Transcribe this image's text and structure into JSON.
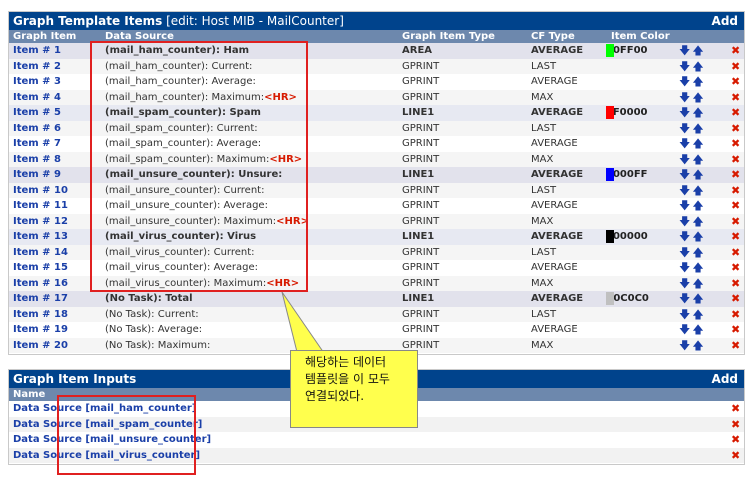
{
  "template_panel": {
    "title_bold": "Graph Template Items",
    "title_rest": "[edit: Host MIB - MailCounter]",
    "add_label": "Add",
    "columns": {
      "item": "Graph Item",
      "ds": "Data Source",
      "type": "Graph Item Type",
      "cf": "CF Type",
      "color": "Item Color"
    },
    "rows": [
      {
        "item": "Item # 1",
        "ds": "(mail_ham_counter): Ham",
        "hr": "",
        "type": "AREA",
        "cf": "AVERAGE",
        "color": "00FF00",
        "swatch": "#00ff00",
        "main": true
      },
      {
        "item": "Item # 2",
        "ds": "(mail_ham_counter): Current:",
        "hr": "",
        "type": "GPRINT",
        "cf": "LAST",
        "color": "",
        "swatch": "",
        "main": false
      },
      {
        "item": "Item # 3",
        "ds": "(mail_ham_counter): Average:",
        "hr": "",
        "type": "GPRINT",
        "cf": "AVERAGE",
        "color": "",
        "swatch": "",
        "main": false
      },
      {
        "item": "Item # 4",
        "ds": "(mail_ham_counter): Maximum:",
        "hr": "<HR>",
        "type": "GPRINT",
        "cf": "MAX",
        "color": "",
        "swatch": "",
        "main": false
      },
      {
        "item": "Item # 5",
        "ds": "(mail_spam_counter): Spam",
        "hr": "",
        "type": "LINE1",
        "cf": "AVERAGE",
        "color": "FF0000",
        "swatch": "#ff0000",
        "main": true
      },
      {
        "item": "Item # 6",
        "ds": "(mail_spam_counter): Current:",
        "hr": "",
        "type": "GPRINT",
        "cf": "LAST",
        "color": "",
        "swatch": "",
        "main": false
      },
      {
        "item": "Item # 7",
        "ds": "(mail_spam_counter): Average:",
        "hr": "",
        "type": "GPRINT",
        "cf": "AVERAGE",
        "color": "",
        "swatch": "",
        "main": false
      },
      {
        "item": "Item # 8",
        "ds": "(mail_spam_counter): Maximum:",
        "hr": "<HR>",
        "type": "GPRINT",
        "cf": "MAX",
        "color": "",
        "swatch": "",
        "main": false
      },
      {
        "item": "Item # 9",
        "ds": "(mail_unsure_counter): Unsure:",
        "hr": "",
        "type": "LINE1",
        "cf": "AVERAGE",
        "color": "0000FF",
        "swatch": "#0000ff",
        "main": true
      },
      {
        "item": "Item # 10",
        "ds": "(mail_unsure_counter): Current:",
        "hr": "",
        "type": "GPRINT",
        "cf": "LAST",
        "color": "",
        "swatch": "",
        "main": false
      },
      {
        "item": "Item # 11",
        "ds": "(mail_unsure_counter): Average:",
        "hr": "",
        "type": "GPRINT",
        "cf": "AVERAGE",
        "color": "",
        "swatch": "",
        "main": false
      },
      {
        "item": "Item # 12",
        "ds": "(mail_unsure_counter): Maximum:",
        "hr": "<HR>",
        "type": "GPRINT",
        "cf": "MAX",
        "color": "",
        "swatch": "",
        "main": false
      },
      {
        "item": "Item # 13",
        "ds": "(mail_virus_counter): Virus",
        "hr": "",
        "type": "LINE1",
        "cf": "AVERAGE",
        "color": "000000",
        "swatch": "#000000",
        "main": true
      },
      {
        "item": "Item # 14",
        "ds": "(mail_virus_counter): Current:",
        "hr": "",
        "type": "GPRINT",
        "cf": "LAST",
        "color": "",
        "swatch": "",
        "main": false
      },
      {
        "item": "Item # 15",
        "ds": "(mail_virus_counter): Average:",
        "hr": "",
        "type": "GPRINT",
        "cf": "AVERAGE",
        "color": "",
        "swatch": "",
        "main": false
      },
      {
        "item": "Item # 16",
        "ds": "(mail_virus_counter): Maximum:",
        "hr": "<HR>",
        "type": "GPRINT",
        "cf": "MAX",
        "color": "",
        "swatch": "",
        "main": false
      },
      {
        "item": "Item # 17",
        "ds": "(No Task): Total",
        "hr": "",
        "type": "LINE1",
        "cf": "AVERAGE",
        "color": "C0C0C0",
        "swatch": "#c0c0c0",
        "main": true
      },
      {
        "item": "Item # 18",
        "ds": "(No Task): Current:",
        "hr": "",
        "type": "GPRINT",
        "cf": "LAST",
        "color": "",
        "swatch": "",
        "main": false
      },
      {
        "item": "Item # 19",
        "ds": "(No Task): Average:",
        "hr": "",
        "type": "GPRINT",
        "cf": "AVERAGE",
        "color": "",
        "swatch": "",
        "main": false
      },
      {
        "item": "Item # 20",
        "ds": "(No Task): Maximum:",
        "hr": "",
        "type": "GPRINT",
        "cf": "MAX",
        "color": "",
        "swatch": "",
        "main": false
      }
    ]
  },
  "inputs_panel": {
    "title": "Graph Item Inputs",
    "add_label": "Add",
    "name_header": "Name",
    "rows": [
      "Data Source [mail_ham_counter]",
      "Data Source [mail_spam_counter]",
      "Data Source [mail_unsure_counter]",
      "Data Source [mail_virus_counter]"
    ]
  },
  "callout": {
    "line1": "해당하는 데이터",
    "line2": "템플릿을 이 모두",
    "line3": "연결되었다."
  },
  "icons": {
    "move_down": "arrow-down-icon",
    "move_up": "arrow-up-icon",
    "delete": "delete-x-icon"
  },
  "colors": {
    "title_bar": "#00438c",
    "header": "#6d88ad",
    "link": "#1a3fa8",
    "delete": "#d71a00",
    "annotation": "#e02020",
    "callout": "#ffff4d"
  }
}
